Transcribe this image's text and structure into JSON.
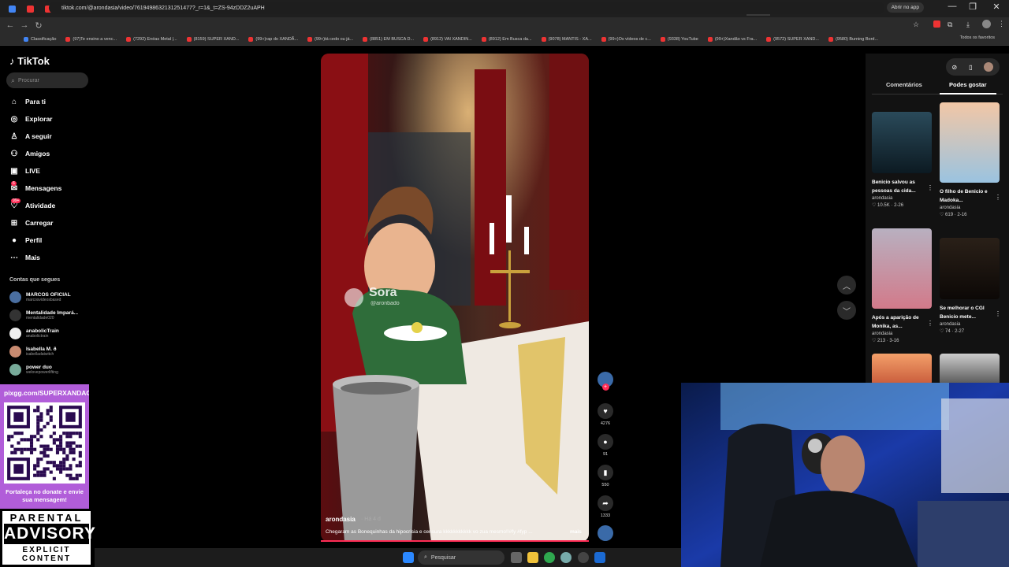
{
  "browser": {
    "url": "tiktok.com/@arondasia/video/7619498632131251477?_r=1&_t=ZS-94zDDZ2uAPH",
    "open_app": "Abrir no app",
    "tab_favicon_colors": [
      "#4285f4",
      "#e33",
      "#e33",
      "#2a8",
      "#e33",
      "#e1306c",
      "#e33",
      "#e33",
      "#25d366",
      "#fff",
      "#e33",
      "#e33",
      "#e33",
      "#e33",
      "#e33",
      "#e33",
      "#e33",
      "#e33",
      "#e33",
      "#e1306c",
      "#e33",
      "#e33",
      "#e33",
      "#e33",
      "#e1306c",
      "#25d366",
      "#e33",
      "#e33",
      "#e33",
      "#e33",
      "#e33",
      "#e33",
      "#fff",
      "#fff",
      "#e33",
      "#e33",
      "#e33",
      "#e33",
      "#fff",
      "#e33",
      "#fff",
      "#fff",
      "#e1306c",
      "#fff"
    ],
    "bookmarks": [
      "Classificação",
      "(97)Te ensino a venc...",
      "(7292) Enéas Metal |...",
      "(8159) SUPER XAND...",
      "(99+)rap do XANDÃ...",
      "(99+)tá cedo ou já...",
      "(8851) EM BUSCA D...",
      "(8912) VAI XANDIN...",
      "(8912) Em Busca da...",
      "(9078) MANTIS - XA...",
      "(99+)Os vídeos de c...",
      "(9338) YouTube",
      "(99+)Xandão vs Fra...",
      "(9572) SUPER XAND...",
      "(9580) Burning Bord..."
    ],
    "all_favorites": "Todos os favoritos"
  },
  "tiktok": {
    "logo": "TikTok",
    "search_placeholder": "Procurar",
    "nav": [
      {
        "label": "Para ti",
        "icon": "home-icon"
      },
      {
        "label": "Explorar",
        "icon": "compass-icon"
      },
      {
        "label": "A seguir",
        "icon": "following-icon"
      },
      {
        "label": "Amigos",
        "icon": "friends-icon"
      },
      {
        "label": "LIVE",
        "icon": "live-icon"
      },
      {
        "label": "Mensagens",
        "icon": "messages-icon",
        "badge": "6"
      },
      {
        "label": "Atividade",
        "icon": "activity-icon",
        "badge": "99+"
      },
      {
        "label": "Carregar",
        "icon": "upload-icon"
      },
      {
        "label": "Perfil",
        "icon": "profile-icon"
      },
      {
        "label": "Mais",
        "icon": "more-icon"
      }
    ],
    "following_title": "Contas que segues",
    "following": [
      {
        "name": "MARCOS OFICIAL",
        "handle": "marcosvideosbased"
      },
      {
        "name": "Mentalidade Impará...",
        "handle": "mentalidade020"
      },
      {
        "name": "anabolicTrain",
        "handle": "anabolictrain"
      },
      {
        "name": "Isabella M. ð",
        "handle": "isabelladatwitch"
      },
      {
        "name": "power duo",
        "handle": "welovepowerlifting"
      }
    ]
  },
  "video": {
    "watermark": "Sora",
    "watermark_handle": "@aronbado",
    "author": "arondasia",
    "age": "· Há 4 d",
    "caption": "Chegaram as Bonequinhas da hipocrisia e censura kkkkkkkkkkk vo zua mesmo!!#fy #fyp ...",
    "more": "mais",
    "likes": "4276",
    "comments": "91",
    "saves": "550",
    "shares": "1333"
  },
  "right_panel": {
    "tabs": [
      "Comentários",
      "Podes gostar"
    ],
    "cards": [
      {
        "title": "Benicio salvou as pessoas da cida...",
        "author": "arondasia",
        "likes": "10.5K",
        "date": "2-26"
      },
      {
        "title": "O filho de Benicio e Madoka...",
        "author": "arondasia",
        "likes": "619",
        "date": "2-16"
      },
      {
        "title": "Após a aparição de Monika, as...",
        "author": "arondasia",
        "likes": "213",
        "date": "3-16"
      },
      {
        "title": "Se melhorar o CGI Benicio mete...",
        "author": "arondasia",
        "likes": "74",
        "date": "2-27"
      }
    ]
  },
  "overlay": {
    "donate_url": "pixgg.com/SUPERXANDAO",
    "donate_msg": "Fortaleça no donate e envie sua mensagem!",
    "advisory_l1": "PARENTAL",
    "advisory_l2": "ADVISORY",
    "advisory_l3": "EXPLICIT CONTENT"
  },
  "taskbar": {
    "search_label": "Pesquisar"
  }
}
